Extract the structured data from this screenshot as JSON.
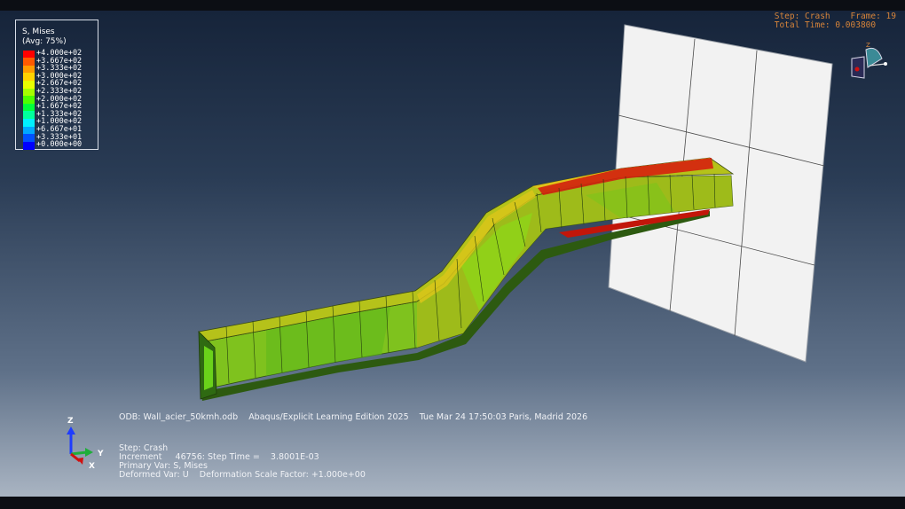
{
  "legend": {
    "title": "S, Mises",
    "subtitle": "(Avg: 75%)",
    "entries": [
      {
        "label": "+4.000e+02",
        "color": "#ff0000"
      },
      {
        "label": "+3.667e+02",
        "color": "#ff5a00"
      },
      {
        "label": "+3.333e+02",
        "color": "#ff9c00"
      },
      {
        "label": "+3.000e+02",
        "color": "#ffd200"
      },
      {
        "label": "+2.667e+02",
        "color": "#e9ff00"
      },
      {
        "label": "+2.333e+02",
        "color": "#a6ff00"
      },
      {
        "label": "+2.000e+02",
        "color": "#4eff00"
      },
      {
        "label": "+1.667e+02",
        "color": "#00ff3a"
      },
      {
        "label": "+1.333e+02",
        "color": "#00ff9c"
      },
      {
        "label": "+1.000e+02",
        "color": "#00f0ff"
      },
      {
        "label": "+6.667e+01",
        "color": "#00a8ff"
      },
      {
        "label": "+3.333e+01",
        "color": "#0052ff"
      },
      {
        "label": "+0.000e+00",
        "color": "#0000ff"
      }
    ]
  },
  "status": {
    "step_line": "Step: Crash    Frame: 19",
    "time_line": "Total Time: 0.003800"
  },
  "info": {
    "odb_line": "ODB: Wall_acier_50kmh.odb    Abaqus/Explicit Learning Edition 2025    Tue Mar 24 17:50:03 Paris, Madrid 2026",
    "step_line": "Step: Crash",
    "increment_line": "Increment     46756: Step Time =    3.8001E-03",
    "primary_line": "Primary Var: S, Mises",
    "deformed_line": "Deformed Var: U    Deformation Scale Factor: +1.000e+00"
  },
  "triad": {
    "z": "Z",
    "y": "Y",
    "x": "X"
  },
  "mini_triad": {
    "z": "Z"
  },
  "colors": {
    "wall": "#f1f1f1",
    "beam_green": "#6fd21c",
    "beam_yellow": "#c6c81a",
    "beam_red": "#d21a0a"
  }
}
